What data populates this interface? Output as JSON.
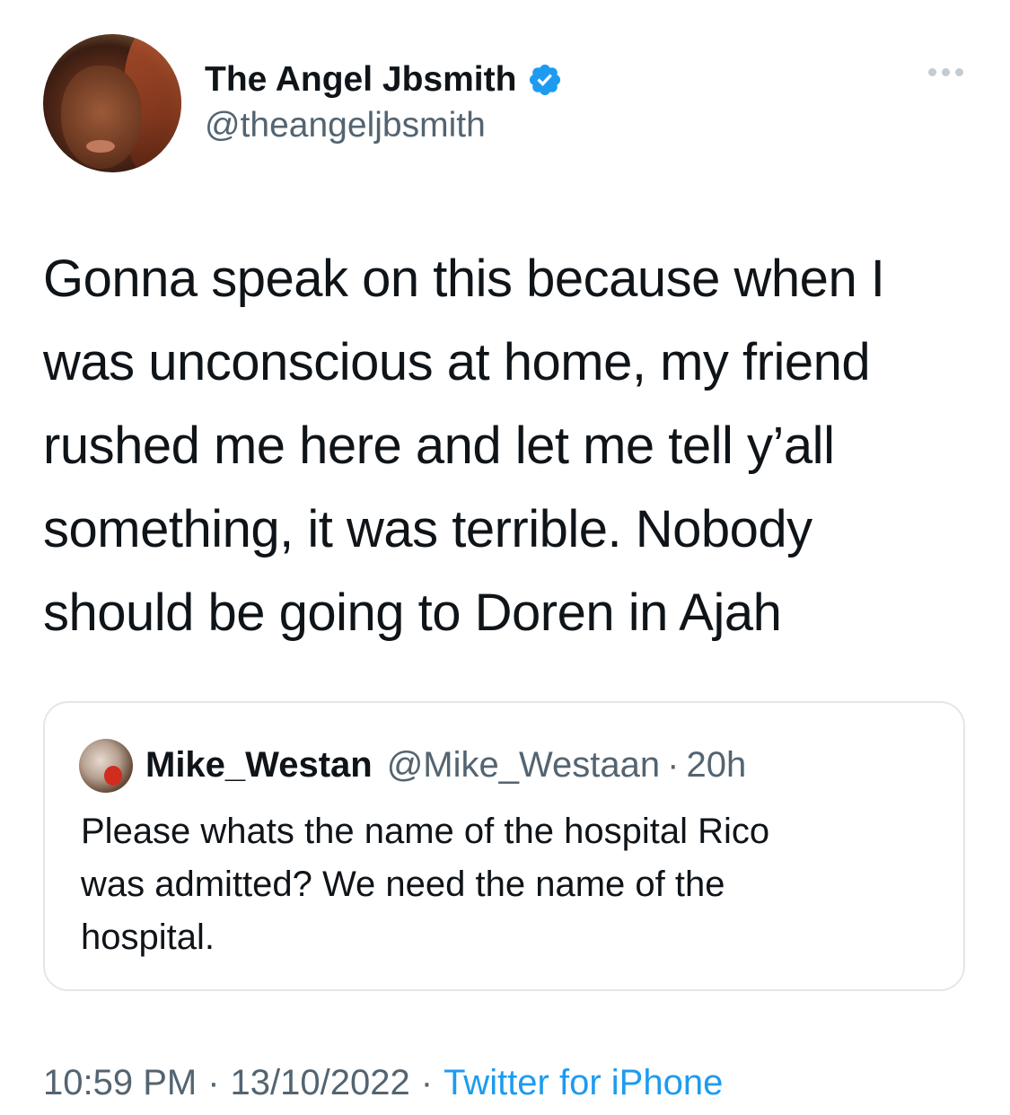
{
  "author": {
    "display_name": "The Angel Jbsmith",
    "handle": "@theangeljbsmith",
    "verified": true,
    "avatar_icon": "profile-photo"
  },
  "more_menu_icon": "more-horizontal-icon",
  "tweet": {
    "lines": [
      "Gonna speak on this because when I",
      "was unconscious at home, my friend",
      "rushed me here and let me tell y’all",
      "something, it was terrible. Nobody",
      "should be going to Doren in Ajah"
    ]
  },
  "quoted_tweet": {
    "display_name": "Mike_Westan",
    "handle": "@Mike_Westaan",
    "dot": "·",
    "time": "20h",
    "lines": [
      "Please whats the name of the hospital Rico",
      "was admitted? We need the name of the",
      "hospital."
    ]
  },
  "meta": {
    "time": "10:59 PM",
    "separator": "·",
    "date": "13/10/2022",
    "source": "Twitter for iPhone"
  },
  "colors": {
    "text_primary": "#0f1419",
    "text_secondary": "#536471",
    "accent": "#1d9bf0",
    "border": "#e3e7ea"
  }
}
